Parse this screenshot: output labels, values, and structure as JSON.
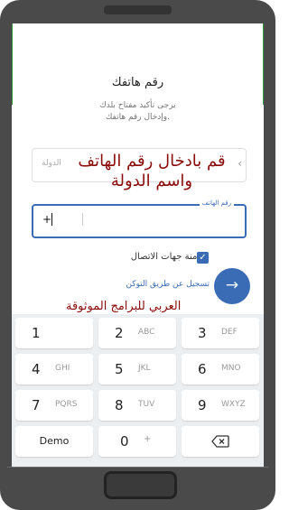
{
  "screen": {
    "title": "رقم هاتفك",
    "subtitle_line1": "يرجى تأكيد مفتاح بلدك",
    "subtitle_line2": "وإدخال رقم هاتفك."
  },
  "country": {
    "placeholder": "الدولة",
    "chevron": "‹"
  },
  "overlay": {
    "line1": "قم بادخال رقم الهاتف",
    "line2": "واسم الدولة"
  },
  "phone": {
    "label": "رقم الهاتف",
    "prefix": "+"
  },
  "sync": {
    "label": "مزامنة جهات الاتصال",
    "checked": true,
    "check_glyph": "✓"
  },
  "token_link": "تسجيل عن طريق التوكن",
  "next_button": {
    "glyph": "→"
  },
  "watermark": "العربي للبرامج الموثوقة",
  "keypad": {
    "keys": [
      {
        "num": "1",
        "letters": ""
      },
      {
        "num": "2",
        "letters": "ABC"
      },
      {
        "num": "3",
        "letters": "DEF"
      },
      {
        "num": "4",
        "letters": "GHI"
      },
      {
        "num": "5",
        "letters": "JKL"
      },
      {
        "num": "6",
        "letters": "MNO"
      },
      {
        "num": "7",
        "letters": "PQRS"
      },
      {
        "num": "8",
        "letters": "TUV"
      },
      {
        "num": "9",
        "letters": "WXYZ"
      },
      {
        "num": "Demo",
        "letters": ""
      },
      {
        "num": "0",
        "letters": "+"
      },
      {
        "num": "",
        "letters": ""
      }
    ]
  },
  "colors": {
    "accent": "#3a6cb5",
    "overlay_text": "#8b0a0a",
    "keypad_bg": "#eceff1"
  }
}
